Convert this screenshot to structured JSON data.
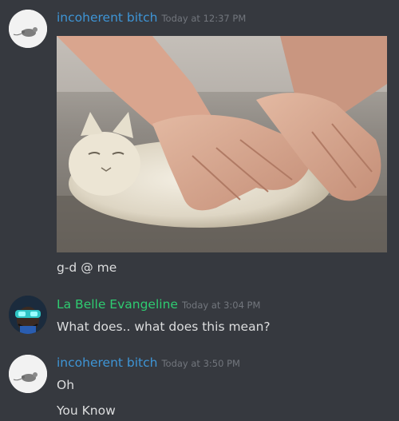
{
  "messages": [
    {
      "username": "incoherent bitch",
      "timestamp": "Today at 12:37 PM",
      "lines": [
        "g-d @ me"
      ]
    },
    {
      "username": "La Belle Evangeline",
      "timestamp": "Today at 3:04 PM",
      "lines": [
        "What does.. what does this mean?"
      ]
    },
    {
      "username": "incoherent bitch",
      "timestamp": "Today at 3:50 PM",
      "lines": [
        "Oh",
        "You Know"
      ]
    }
  ],
  "colors": {
    "background": "#36393f",
    "username_blue": "#3e95d6",
    "username_green": "#2ecc71",
    "timestamp": "#72767d",
    "text": "#dcddde"
  },
  "icons": {
    "avatar_1": "mouse-avatar-icon",
    "avatar_2": "goggles-avatar-icon",
    "attachment": "cat-dough-image"
  }
}
